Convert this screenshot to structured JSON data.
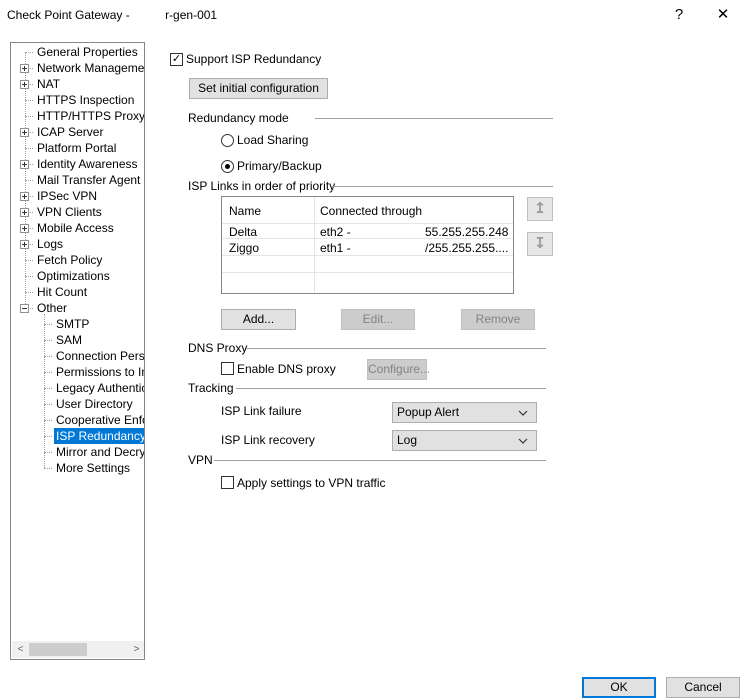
{
  "window": {
    "title": "Check Point Gateway - ",
    "title_suffix": "r-gen-001",
    "help_glyph": "?",
    "close_glyph": "✕"
  },
  "tree": {
    "items": [
      {
        "label": "General Properties",
        "expander": "none"
      },
      {
        "label": "Network Management",
        "expander": "plus"
      },
      {
        "label": "NAT",
        "expander": "plus"
      },
      {
        "label": "HTTPS Inspection",
        "expander": "none"
      },
      {
        "label": "HTTP/HTTPS Proxy",
        "expander": "none"
      },
      {
        "label": "ICAP Server",
        "expander": "plus"
      },
      {
        "label": "Platform Portal",
        "expander": "none"
      },
      {
        "label": "Identity Awareness",
        "expander": "plus"
      },
      {
        "label": "Mail Transfer Agent",
        "expander": "none"
      },
      {
        "label": "IPSec VPN",
        "expander": "plus"
      },
      {
        "label": "VPN Clients",
        "expander": "plus"
      },
      {
        "label": "Mobile Access",
        "expander": "plus"
      },
      {
        "label": "Logs",
        "expander": "plus"
      },
      {
        "label": "Fetch Policy",
        "expander": "none"
      },
      {
        "label": "Optimizations",
        "expander": "none"
      },
      {
        "label": "Hit Count",
        "expander": "none"
      },
      {
        "label": "Other",
        "expander": "minus"
      },
      {
        "label": "SMTP",
        "expander": "child"
      },
      {
        "label": "SAM",
        "expander": "child"
      },
      {
        "label": "Connection Persist",
        "expander": "child"
      },
      {
        "label": "Permissions to Insta",
        "expander": "child"
      },
      {
        "label": "Legacy Authentica",
        "expander": "child"
      },
      {
        "label": "User Directory",
        "expander": "child"
      },
      {
        "label": "Cooperative Enforc",
        "expander": "child"
      },
      {
        "label": "ISP Redundancy",
        "expander": "child",
        "selected": true
      },
      {
        "label": "Mirror and Decrypt",
        "expander": "child"
      },
      {
        "label": "More Settings",
        "expander": "child"
      }
    ],
    "scroll_left": "<",
    "scroll_right": ">"
  },
  "main": {
    "support_isp_label": "Support ISP Redundancy",
    "support_isp_checked": true,
    "set_initial_config_label": "Set initial configuration",
    "redundancy_mode_label": "Redundancy mode",
    "load_sharing_label": "Load Sharing",
    "primary_backup_label": "Primary/Backup",
    "selected_mode": "primary_backup",
    "isp_links_label": "ISP Links in order of priority",
    "table": {
      "headers": [
        "Name",
        "Connected through"
      ],
      "rows": [
        {
          "name": "Delta",
          "iface": "eth2 -",
          "addr": "55.255.255.248"
        },
        {
          "name": "Ziggo",
          "iface": "eth1 -",
          "addr": "/255.255.255...."
        }
      ]
    },
    "move_up_glyph": "↥",
    "move_down_glyph": "↧",
    "add_label": "Add...",
    "edit_label": "Edit...",
    "remove_label": "Remove",
    "dns_proxy_label": "DNS Proxy",
    "enable_dns_label": "Enable DNS proxy",
    "configure_label": "Configure...",
    "tracking_label": "Tracking",
    "link_failure_label": "ISP Link failure",
    "link_failure_value": "Popup Alert",
    "link_recovery_label": "ISP Link recovery",
    "link_recovery_value": "Log",
    "vpn_label": "VPN",
    "apply_vpn_label": "Apply settings to VPN traffic"
  },
  "footer": {
    "ok_label": "OK",
    "cancel_label": "Cancel"
  },
  "colors": {
    "selection": "#0078d7",
    "default_button_border": "#0078d7"
  }
}
